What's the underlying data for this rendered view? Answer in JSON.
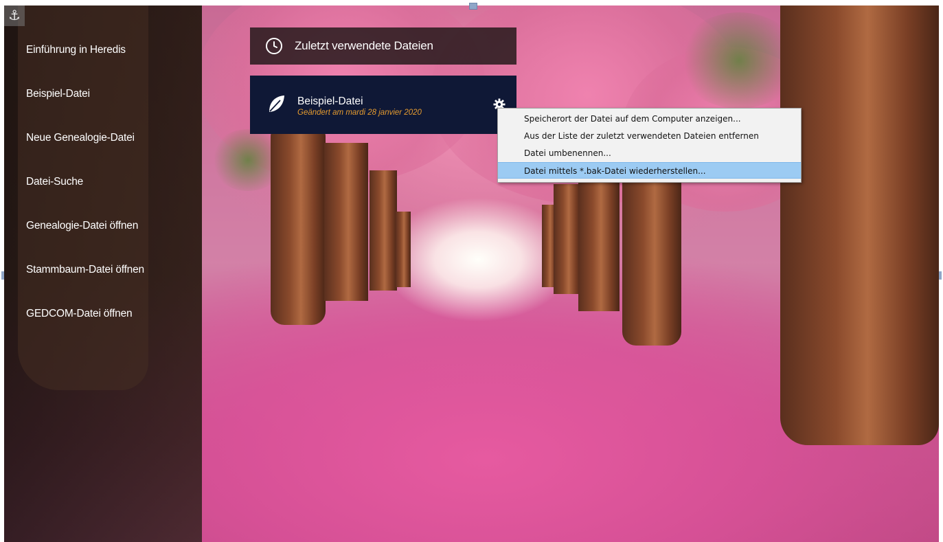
{
  "sidebar": {
    "items": [
      {
        "label": "Einführung in Heredis"
      },
      {
        "label": "Beispiel-Datei"
      },
      {
        "label": "Neue Genealogie-Datei"
      },
      {
        "label": "Datei-Suche"
      },
      {
        "label": "Genealogie-Datei öffnen"
      },
      {
        "label": "Stammbaum-Datei öffnen"
      },
      {
        "label": "GEDCOM-Datei öffnen"
      }
    ]
  },
  "recent": {
    "header_title": "Zuletzt verwendete Dateien",
    "icon": "clock-icon",
    "files": [
      {
        "name": "Beispiel-Datei",
        "modified": "Geändert am mardi 28 janvier 2020",
        "icon": "leaf-icon"
      }
    ]
  },
  "context_menu": {
    "items": [
      {
        "label": "Speicherort der Datei auf dem Computer anzeigen...",
        "selected": false
      },
      {
        "label": "Aus der Liste der zuletzt verwendeten Dateien entfernen",
        "selected": false
      },
      {
        "label": "Datei umbenennen...",
        "selected": false
      },
      {
        "label": "Datei mittels *.bak-Datei wiederherstellen...",
        "selected": true
      }
    ]
  },
  "colors": {
    "file_card_bg": "#0f1836",
    "modified_date": "#e59b2f",
    "menu_highlight": "#9ccbf3"
  }
}
